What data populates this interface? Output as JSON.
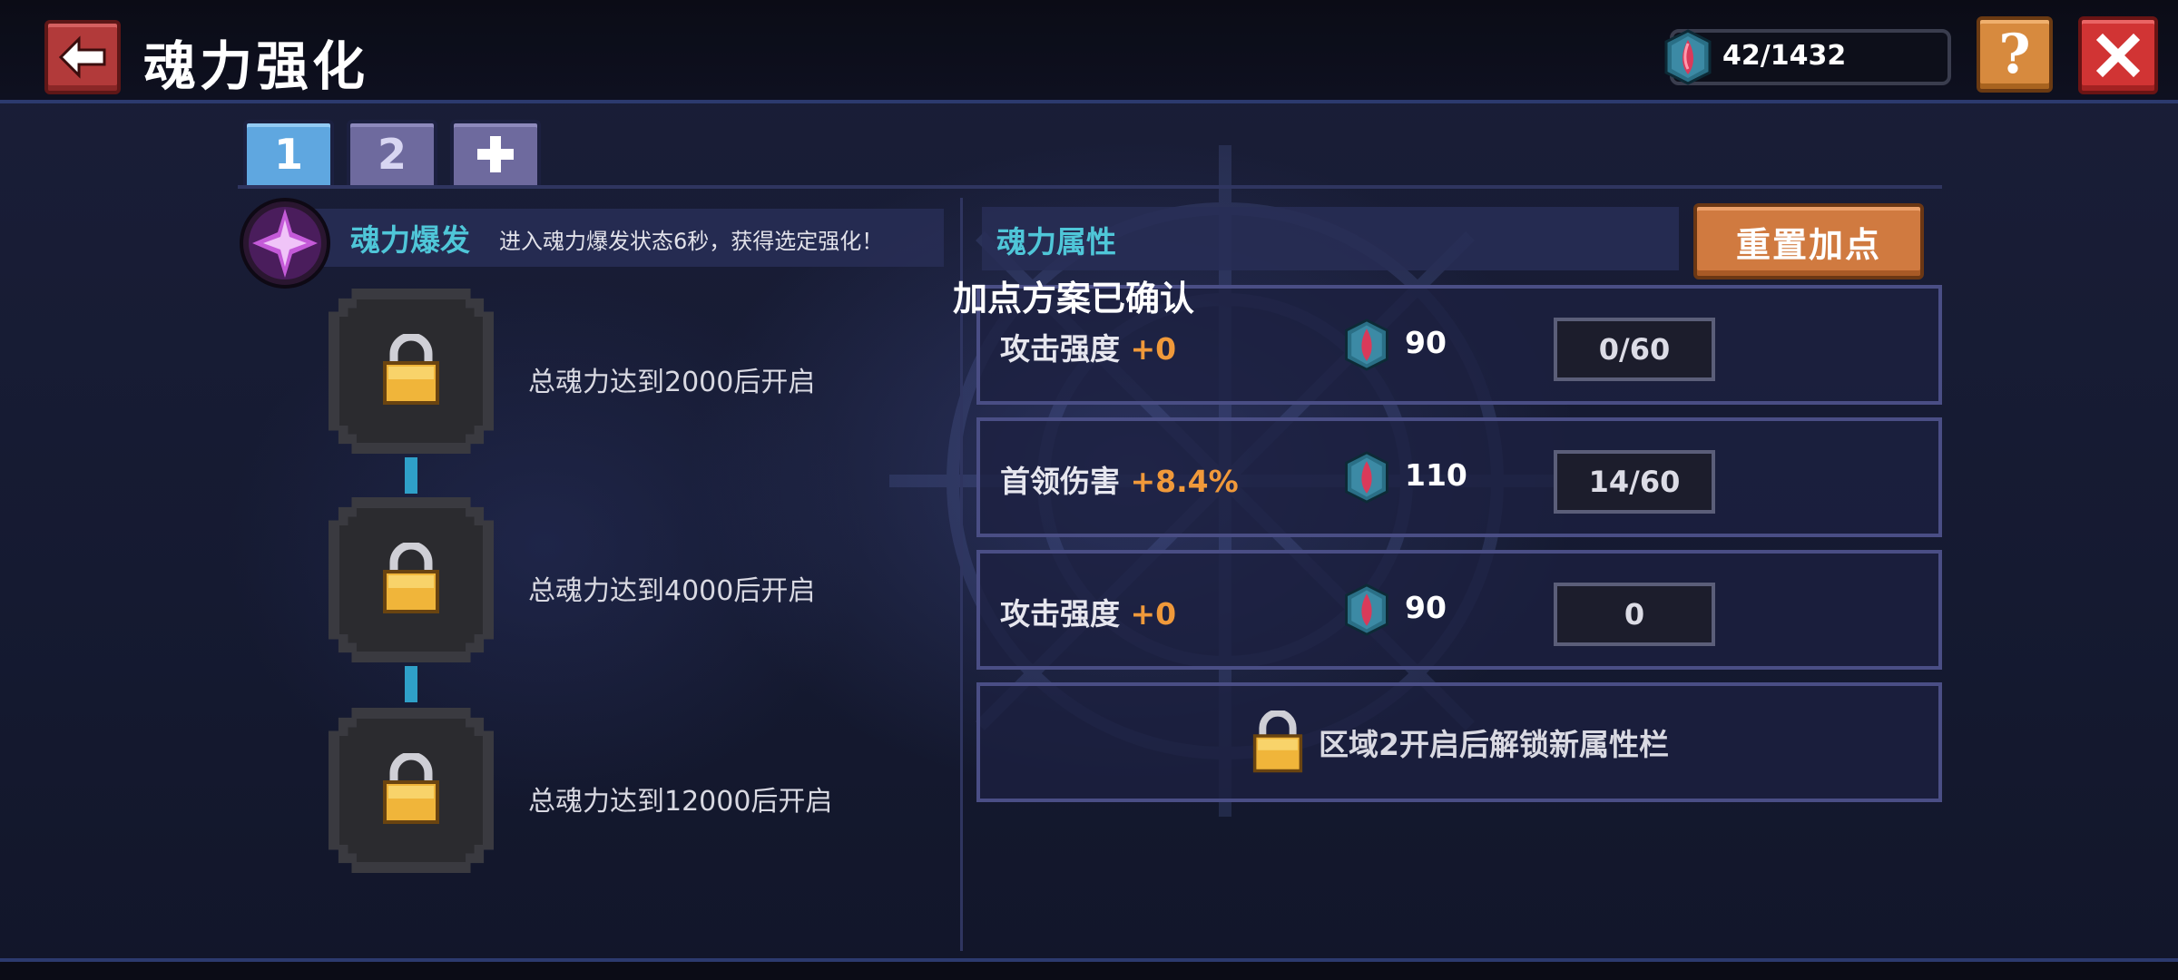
{
  "header": {
    "title": "魂力强化",
    "currency_value": "42/1432",
    "help_label": "?"
  },
  "tabs": [
    {
      "label": "1",
      "active": true
    },
    {
      "label": "2",
      "active": false
    }
  ],
  "add_tab_icon": "plus-icon",
  "soul_burst": {
    "title": "魂力爆发",
    "description": "进入魂力爆发状态6秒，获得选定强化！"
  },
  "nodes": [
    {
      "label": "总魂力达到2000后开启",
      "locked": true
    },
    {
      "label": "总魂力达到4000后开启",
      "locked": true
    },
    {
      "label": "总魂力达到12000后开启",
      "locked": true
    }
  ],
  "attributes": {
    "title": "魂力属性",
    "reset_label": "重置加点",
    "toast": "加点方案已确认",
    "rows": [
      {
        "name": "攻击强度",
        "bonus": "+0",
        "cost": "90",
        "level": "0/60"
      },
      {
        "name": "首领伤害",
        "bonus": "+8.4%",
        "cost": "110",
        "level": "14/60"
      },
      {
        "name": "攻击强度",
        "bonus": "+0",
        "cost": "90",
        "level": "0"
      }
    ],
    "locked_row_text": "区域2开启后解锁新属性栏"
  },
  "colors": {
    "accent_cyan": "#4fc6d8",
    "bonus_orange": "#f0993a",
    "reset_orange": "#d07a40",
    "close_red": "#d13434",
    "tab_active": "#5fa7e0"
  }
}
